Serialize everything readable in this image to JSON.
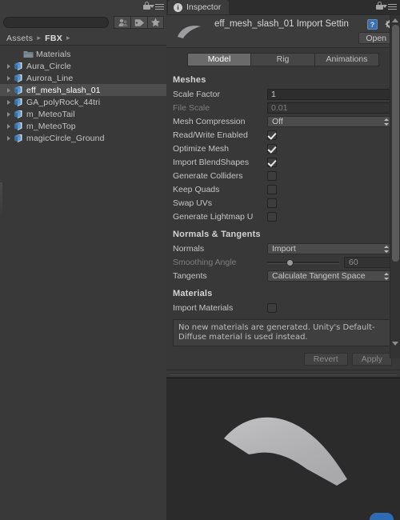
{
  "project_panel": {
    "window_icons": {
      "lock": "lock-icon",
      "menu": "menu-icon"
    },
    "search": {
      "value": "",
      "placeholder": ""
    },
    "filter_buttons": [
      {
        "name": "filter-by-type",
        "icon": "people-icon"
      },
      {
        "name": "filter-by-label",
        "icon": "label-tag-icon"
      },
      {
        "name": "favorites",
        "icon": "star-icon"
      }
    ],
    "breadcrumb": {
      "root": "Assets",
      "folder": "FBX",
      "separator": "▸"
    },
    "tree": [
      {
        "label": "Materials",
        "icon": "folder-icon",
        "indent": 1,
        "expandable": false,
        "selected": false
      },
      {
        "label": "Aura_Circle",
        "icon": "prefab-model-icon",
        "indent": 0,
        "expandable": true,
        "selected": false
      },
      {
        "label": "Aurora_Line",
        "icon": "prefab-model-icon",
        "indent": 0,
        "expandable": true,
        "selected": false
      },
      {
        "label": "eff_mesh_slash_01",
        "icon": "prefab-model-icon",
        "indent": 0,
        "expandable": true,
        "selected": true
      },
      {
        "label": "GA_polyRock_44tri",
        "icon": "prefab-model-icon",
        "indent": 0,
        "expandable": true,
        "selected": false
      },
      {
        "label": "m_MeteoTail",
        "icon": "prefab-model-icon",
        "indent": 0,
        "expandable": true,
        "selected": false
      },
      {
        "label": "m_MeteoTop",
        "icon": "prefab-model-icon",
        "indent": 0,
        "expandable": true,
        "selected": false
      },
      {
        "label": "magicCircle_Ground",
        "icon": "prefab-model-icon",
        "indent": 0,
        "expandable": true,
        "selected": false
      }
    ]
  },
  "inspector": {
    "tab_label": "Inspector",
    "title": "eff_mesh_slash_01 Import Settin",
    "help_icon_label": "?",
    "open_button": "Open",
    "tabs": [
      {
        "label": "Model",
        "active": true
      },
      {
        "label": "Rig",
        "active": false
      },
      {
        "label": "Animations",
        "active": false
      }
    ],
    "sections": {
      "meshes": {
        "title": "Meshes",
        "scale_factor": {
          "label": "Scale Factor",
          "value": "1"
        },
        "file_scale": {
          "label": "File Scale",
          "value": "0.01"
        },
        "mesh_compression": {
          "label": "Mesh Compression",
          "value": "Off"
        },
        "read_write_enabled": {
          "label": "Read/Write Enabled",
          "checked": true
        },
        "optimize_mesh": {
          "label": "Optimize Mesh",
          "checked": true
        },
        "import_blendshapes": {
          "label": "Import BlendShapes",
          "checked": true
        },
        "generate_colliders": {
          "label": "Generate Colliders",
          "checked": false
        },
        "keep_quads": {
          "label": "Keep Quads",
          "checked": false
        },
        "swap_uvs": {
          "label": "Swap UVs",
          "checked": false
        },
        "generate_lightmap_uvs": {
          "label": "Generate Lightmap U",
          "checked": false
        }
      },
      "normals_tangents": {
        "title": "Normals & Tangents",
        "normals": {
          "label": "Normals",
          "value": "Import"
        },
        "smoothing_angle": {
          "label": "Smoothing Angle",
          "value": "60"
        },
        "tangents": {
          "label": "Tangents",
          "value": "Calculate Tangent Space"
        }
      },
      "materials": {
        "title": "Materials",
        "import_materials": {
          "label": "Import Materials",
          "checked": false
        },
        "help_text": "No new materials are generated. Unity's Default-Diffuse material is used instead."
      }
    },
    "buttons": {
      "revert": "Revert",
      "apply": "Apply"
    }
  },
  "preview": {
    "name": "mesh-preview",
    "mesh_color": "#b3b3b5",
    "background": "#2b2b2b"
  },
  "colors": {
    "panel_bg": "#383838",
    "selection": "#4d4d4d",
    "accent_blue": "#2d6cb5",
    "tab_active": "#6a6a6a"
  }
}
